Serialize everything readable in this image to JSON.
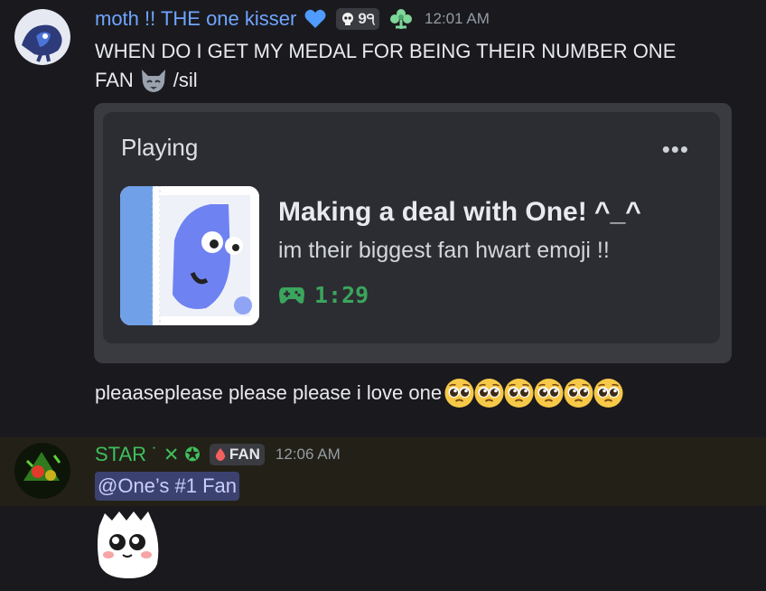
{
  "messages": [
    {
      "username": "moth !! THE one kisser",
      "username_color": "#6fa5ff",
      "tag_text": "9੧",
      "timestamp": "12:01 AM",
      "line1": "WHEN DO I GET MY MEDAL FOR BEING THEIR NUMBER ONE",
      "line2": "FAN",
      "line2_suffix": "/sil",
      "embed": {
        "label": "Playing",
        "more": "•••",
        "title": "Making a deal with One! ^_^",
        "subtitle": "im their biggest fan hwart emoji !!",
        "timer": "1:29"
      },
      "followup": "pleaaseplease please please i love one",
      "emoji_count": 6
    },
    {
      "username": "STAR",
      "username_color": "#3fbf5f",
      "name_decor": "˙ ✕ ✪",
      "role_badge": "FAN",
      "timestamp": "12:06 AM",
      "mention": "@One’s #1 Fan"
    }
  ],
  "icons": [
    "blue-heart-icon",
    "skull-icon",
    "flower-icon",
    "wolf-emoji-icon",
    "gamepad-icon",
    "pleading-face-emoji-icon",
    "drop-icon",
    "ghost-sticker-icon"
  ]
}
